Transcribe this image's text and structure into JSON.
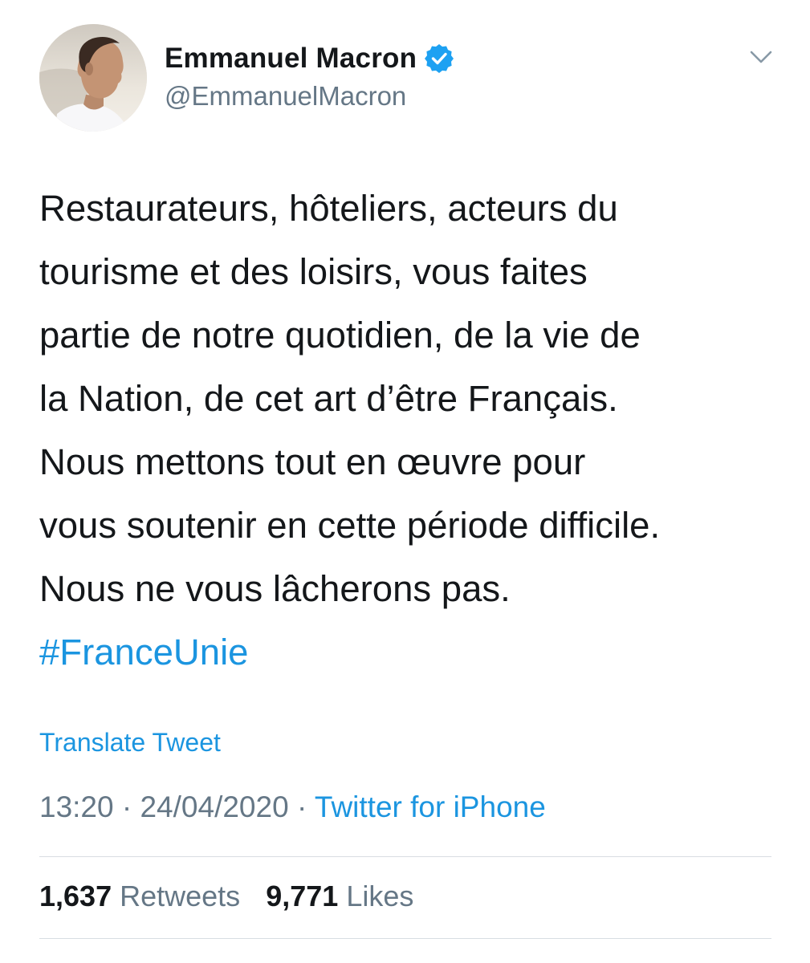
{
  "author": {
    "display_name": "Emmanuel Macron",
    "handle": "@EmmanuelMacron",
    "verified": true
  },
  "tweet": {
    "lines": [
      "Restaurateurs, hôteliers, acteurs du",
      "tourisme et des loisirs, vous faites",
      "partie de notre quotidien, de la vie de",
      "la Nation, de cet art d’être Français.",
      "Nous mettons tout en œuvre pour",
      "vous soutenir en cette période difficile.",
      "Nous ne vous lâcherons pas."
    ],
    "hashtag": "#FranceUnie"
  },
  "translate_label": "Translate Tweet",
  "meta": {
    "time": "13:20",
    "separator": " · ",
    "date": "24/04/2020",
    "source": "Twitter for iPhone"
  },
  "stats": {
    "retweets_count": "1,637",
    "retweets_label": "Retweets",
    "likes_count": "9,771",
    "likes_label": "Likes"
  },
  "colors": {
    "link": "#1b95e0",
    "verified": "#1da1f2",
    "secondary_text": "#657786",
    "primary_text": "#14171a"
  },
  "icons": [
    "verified-badge-icon",
    "chevron-down-icon"
  ]
}
